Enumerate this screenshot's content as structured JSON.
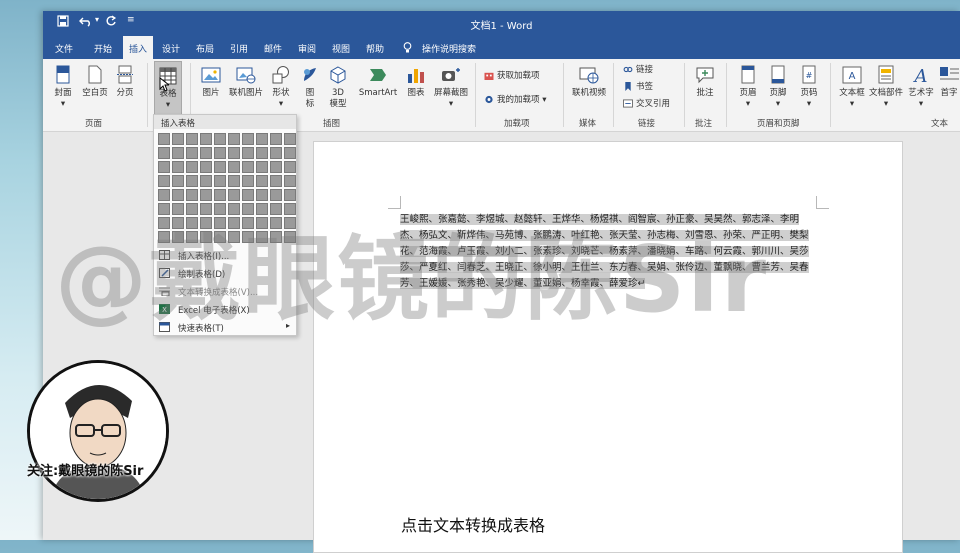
{
  "window": {
    "title": "文档1 - Word"
  },
  "quick_access": {
    "save": "save-icon",
    "undo": "undo-icon",
    "redo": "redo-icon",
    "customize": "customize-icon"
  },
  "menu": {
    "tabs": [
      "文件",
      "开始",
      "插入",
      "设计",
      "布局",
      "引用",
      "邮件",
      "审阅",
      "视图",
      "帮助"
    ],
    "active": "插入",
    "tell_me": "操作说明搜索"
  },
  "ribbon": {
    "pages": {
      "cover": "封面",
      "blank": "空白页",
      "break": "分页",
      "group": "页面"
    },
    "table": {
      "label": "表格"
    },
    "illustrations": {
      "picture": "图片",
      "online_picture": "联机图片",
      "shapes": "形状",
      "icons": "图标",
      "model3d": "3D 模型",
      "smartart": "SmartArt",
      "chart": "图表",
      "screenshot": "屏幕截图",
      "group": "插图"
    },
    "addins": {
      "get": "获取加载项",
      "my": "我的加载项",
      "group": "加载项"
    },
    "media": {
      "online_video": "联机视频",
      "group": "媒体"
    },
    "links": {
      "link": "链接",
      "bookmark": "书签",
      "crossref": "交叉引用",
      "group": "链接"
    },
    "comments": {
      "comment": "批注",
      "group": "批注"
    },
    "header_footer": {
      "header": "页眉",
      "footer": "页脚",
      "page_number": "页码",
      "group": "页眉和页脚"
    },
    "text": {
      "textbox": "文本框",
      "quickparts": "文档部件",
      "wordart": "艺术字",
      "dropcap": "首字",
      "group": "文本"
    }
  },
  "dropdown": {
    "header": "插入表格",
    "items": [
      "插入表格(I)...",
      "绘制表格(D)",
      "文本转换成表格(V)...",
      "Excel 电子表格(X)",
      "快速表格(T)"
    ]
  },
  "document": {
    "text": "王峻熙、张嘉懿、李煜城、赵懿轩、王烨华、杨煜祺、阎智宸、孙正豪、吴昊然、郭志泽、李明杰、杨弘文、靳烨伟、马苑博、张鹏涛、叶红艳、张天莹、孙志梅、刘雪恩、孙荣、严正明、樊梨花、范海霞、卢玉霞、刘小二、张素珍、刘晓芒、杨素萍、潘晓娟、车路、何云霞、郭川川、吴莎莎、严夏红、闫春芝、王晓正、徐小明、王仕兰、东方春、吴娟、张伶边、董飘晓、曹兰芳、吴春芳、王媛媛、张秀艳、吴少耀、董亚娟、杨幸霞、薛爱珍↵"
  },
  "overlay": {
    "watermark": "@戴眼镜的陈Sir",
    "follow": "关注:戴眼镜的陈Sir",
    "caption": "点击文本转换成表格"
  },
  "colors": {
    "word_blue": "#2b579a",
    "ribbon_bg": "#f3f3f3"
  }
}
